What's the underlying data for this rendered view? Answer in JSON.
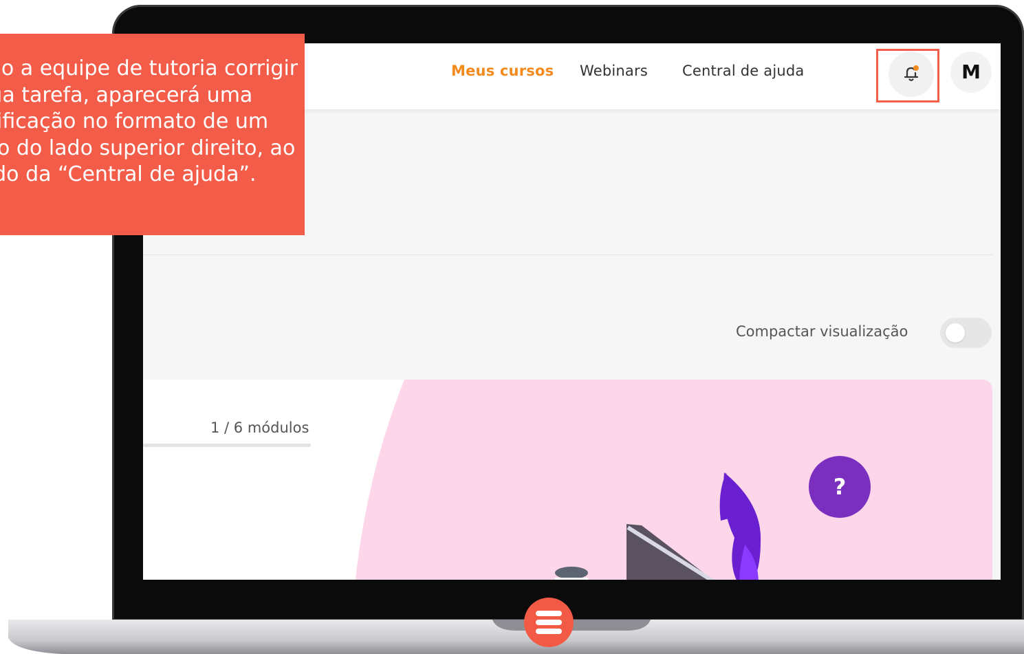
{
  "nav": {
    "links": [
      {
        "label": "Meus cursos",
        "active": true
      },
      {
        "label": "Webinars",
        "active": false
      },
      {
        "label": "Central de ajuda",
        "active": false
      }
    ],
    "notification_icon": "bell-icon",
    "avatar_initial": "M"
  },
  "view": {
    "toggle_label": "Compactar visualização",
    "toggle_on": false
  },
  "course": {
    "modules_progress": "1 / 6 módulos"
  },
  "help": {
    "label": "?"
  },
  "callout": {
    "text": "Quando a equipe de tutoria corrigir sua tarefa, aparecerá uma notificação no formato de um sininho do lado superior direito, ao lado da “Central de ajuda”."
  },
  "colors": {
    "accent": "#f28a1e",
    "callout": "#f25c48",
    "help_button": "#7b2fbf",
    "card_art": "#fdd6ea",
    "flame": "#6a1fd0"
  }
}
